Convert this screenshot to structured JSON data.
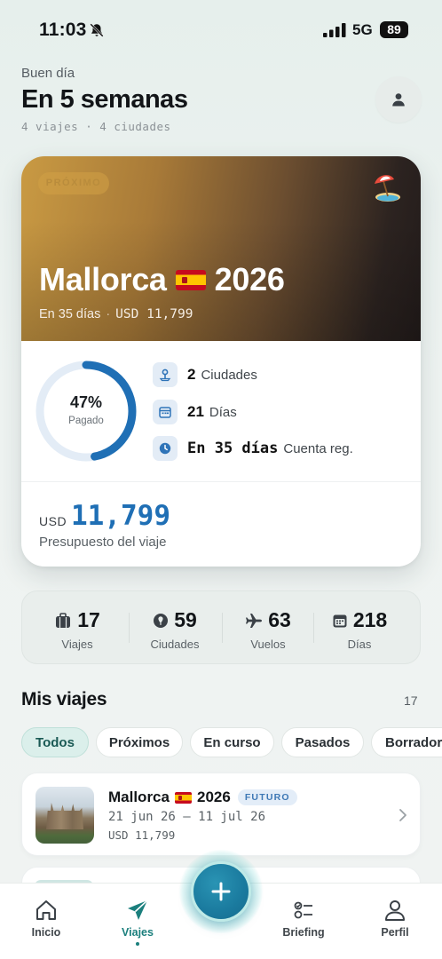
{
  "status_bar": {
    "time": "11:03",
    "network": "5G",
    "battery": "89"
  },
  "header": {
    "greeting": "Buen día",
    "title": "En 5 semanas",
    "summary": "4 viajes · 4 ciudades"
  },
  "hero": {
    "badge": "PRÓXIMO",
    "title_name": "Mallorca",
    "title_year": "2026",
    "meta_days": "En 35 días",
    "meta_dot": "·",
    "meta_budget": "USD 11,799",
    "progress_percent": 47,
    "progress_label": "47%",
    "progress_caption": "Pagado",
    "stats": [
      {
        "icon": "map-pin-icon",
        "value": "2",
        "label": "Ciudades"
      },
      {
        "icon": "calendar-icon",
        "value": "21",
        "label": "Días"
      },
      {
        "icon": "clock-icon",
        "value": "En 35 días",
        "label": "Cuenta reg."
      }
    ],
    "budget_currency": "USD",
    "budget_amount": "11,799",
    "budget_label": "Presupuesto del viaje",
    "colors": {
      "accent": "#1f6fb5",
      "ring_track": "#e3ecf6"
    }
  },
  "overview": [
    {
      "icon": "suitcase-icon",
      "value": "17",
      "label": "Viajes"
    },
    {
      "icon": "city-pin-icon",
      "value": "59",
      "label": "Ciudades"
    },
    {
      "icon": "plane-icon",
      "value": "63",
      "label": "Vuelos"
    },
    {
      "icon": "calendar-icon",
      "value": "218",
      "label": "Días"
    }
  ],
  "section": {
    "title": "Mis viajes",
    "count": "17"
  },
  "filters": [
    {
      "label": "Todos",
      "active": true
    },
    {
      "label": "Próximos",
      "active": false
    },
    {
      "label": "En curso",
      "active": false
    },
    {
      "label": "Pasados",
      "active": false
    },
    {
      "label": "Borrador",
      "active": false
    }
  ],
  "trip_card": {
    "name": "Mallorca",
    "year": "2026",
    "status": "FUTURO",
    "dates": "21 jun 26 — 11 jul 26",
    "budget": "USD 11,799"
  },
  "tabs": [
    {
      "label": "Inicio",
      "icon": "home-icon",
      "active": false
    },
    {
      "label": "Viajes",
      "icon": "paper-plane-icon",
      "active": true
    },
    {
      "label": "Briefing",
      "icon": "checklist-icon",
      "active": false
    },
    {
      "label": "Perfil",
      "icon": "person-icon",
      "active": false
    }
  ],
  "theme": {
    "primary": "#1b7f7d",
    "fab": "#1a7a9e"
  }
}
